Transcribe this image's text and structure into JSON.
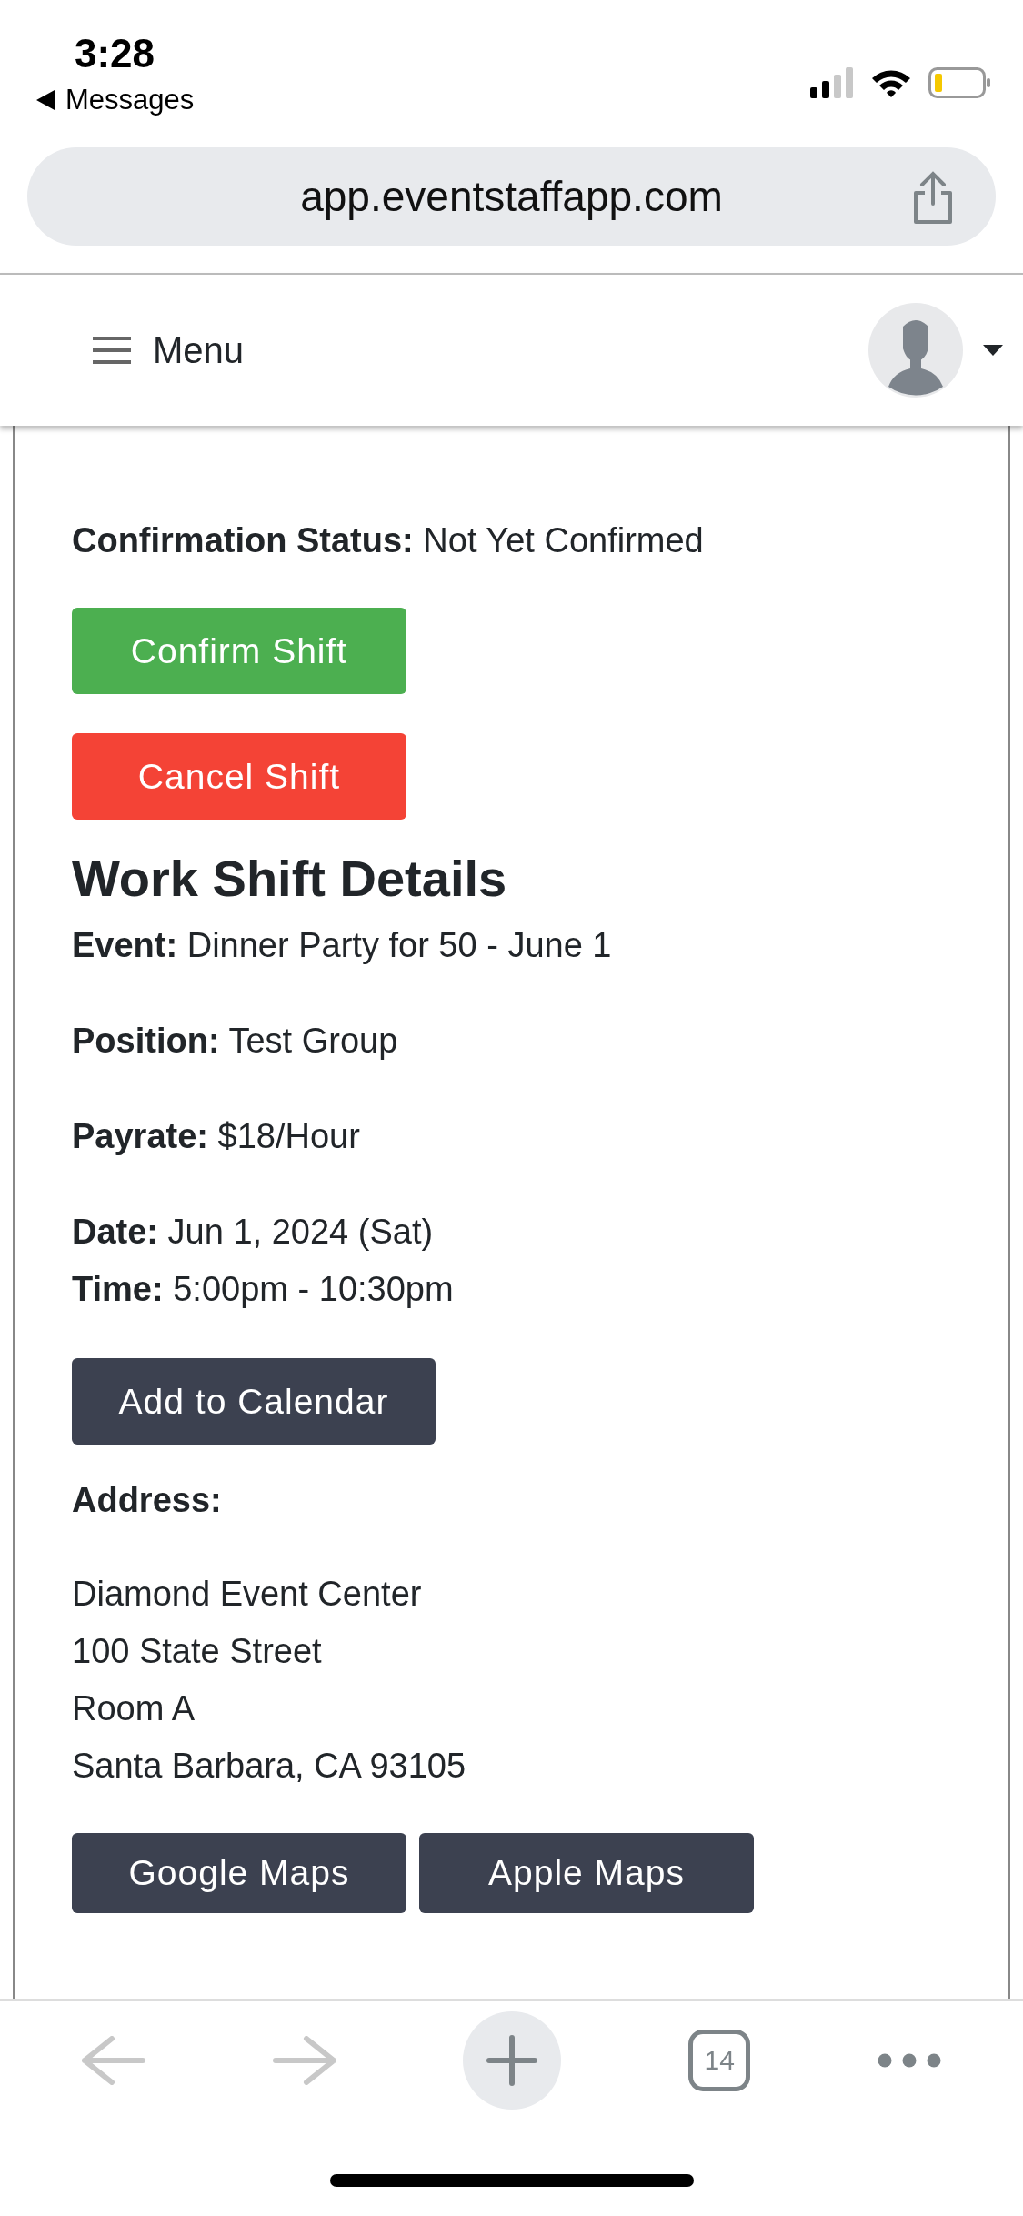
{
  "status_bar": {
    "time": "3:28",
    "back_label": "Messages"
  },
  "browser": {
    "url": "app.eventstaffapp.com",
    "tab_count": "14"
  },
  "navbar": {
    "menu_label": "Menu"
  },
  "confirmation": {
    "label": "Confirmation Status:",
    "value": "Not Yet Confirmed"
  },
  "actions": [
    {
      "label": "Confirm Shift",
      "kind": "confirm"
    },
    {
      "label": "Cancel Shift",
      "kind": "cancel"
    }
  ],
  "details": {
    "heading": "Work Shift Details",
    "groups": [
      [
        {
          "label": "Event:",
          "value": "Dinner Party for 50 - June 1"
        }
      ],
      [
        {
          "label": "Position:",
          "value": "Test Group"
        }
      ],
      [
        {
          "label": "Payrate:",
          "value": "$18/Hour"
        }
      ],
      [
        {
          "label": "Date:",
          "value": "Jun 1, 2024 (Sat)"
        },
        {
          "label": "Time:",
          "value": "5:00pm - 10:30pm"
        }
      ]
    ],
    "calendar_button": "Add to Calendar",
    "address_label": "Address:",
    "address_lines": [
      "Diamond Event Center",
      "100 State Street",
      "Room A",
      "Santa Barbara, CA 93105"
    ],
    "map_buttons": [
      "Google Maps",
      "Apple Maps"
    ]
  }
}
